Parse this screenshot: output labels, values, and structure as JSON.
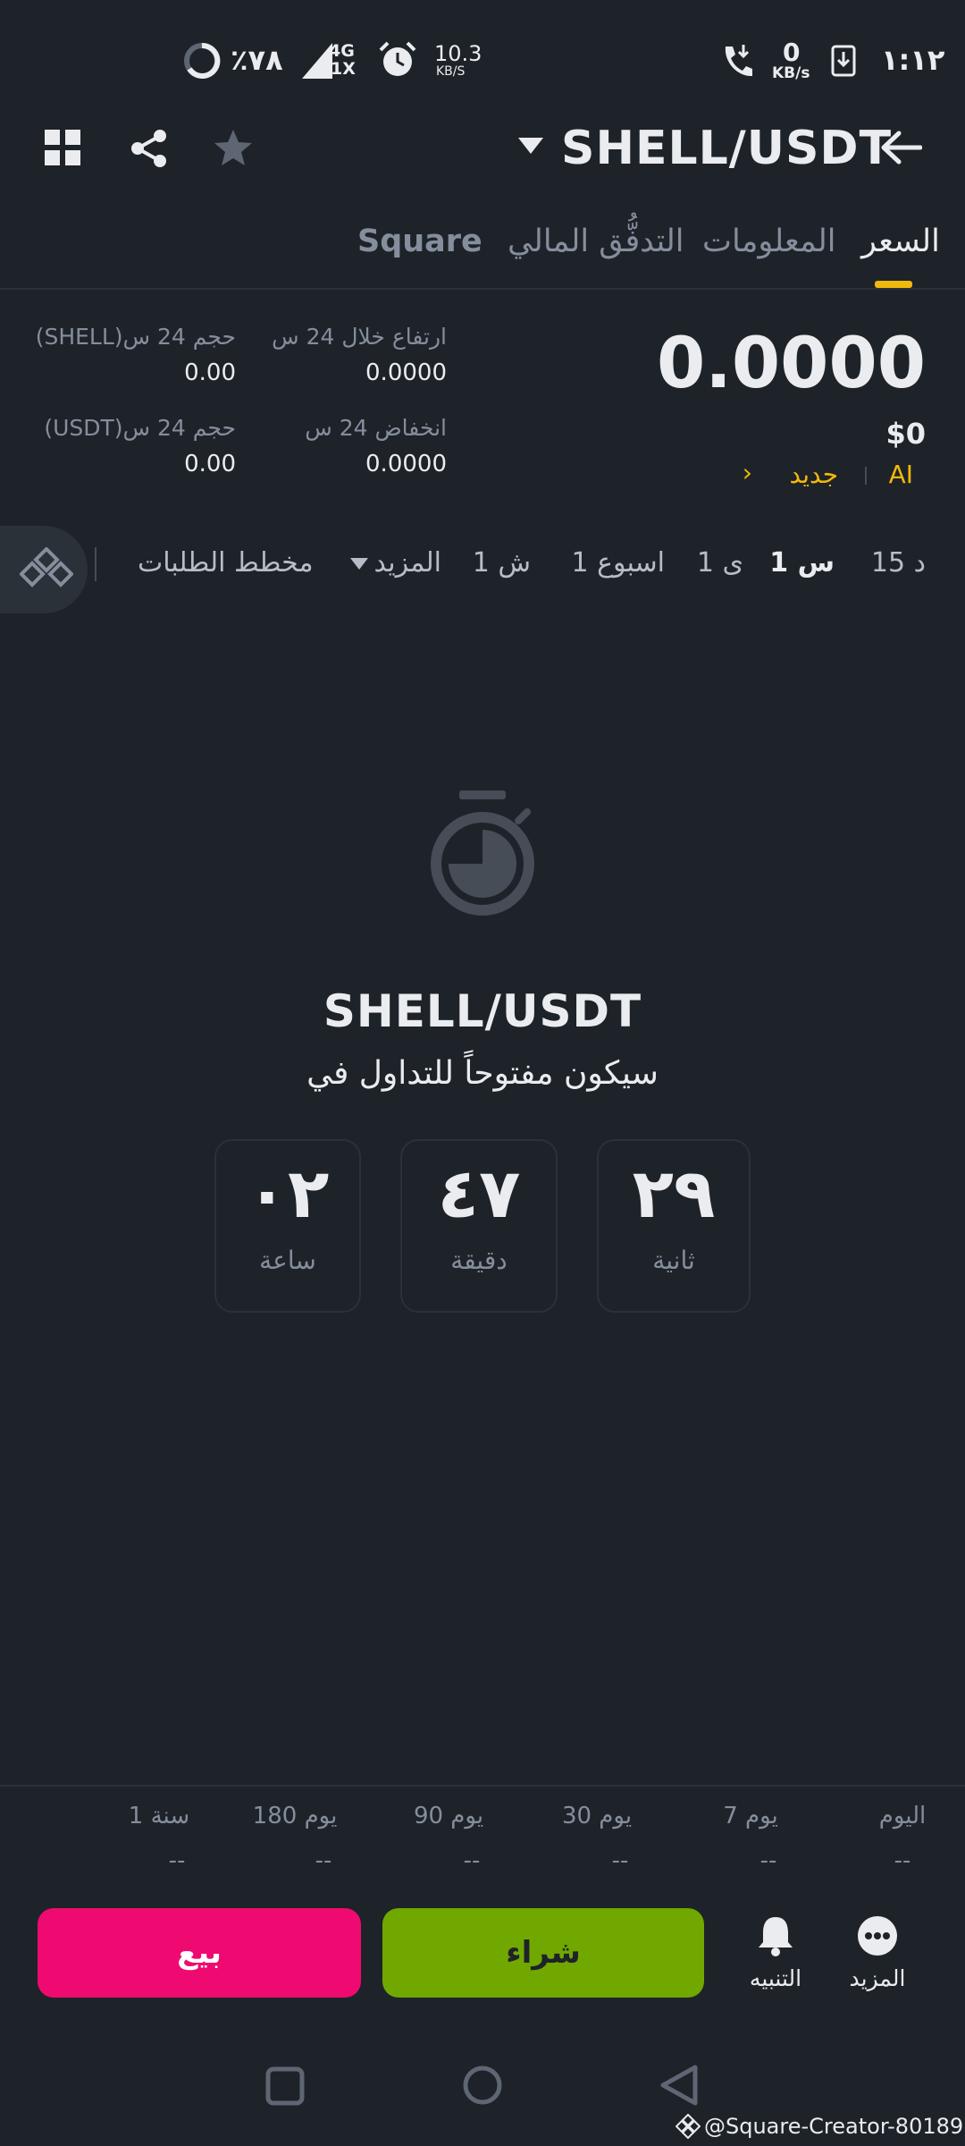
{
  "status_bar": {
    "time": "١:١٢",
    "net_speed_value": "0",
    "net_speed_unit": "KB/s",
    "data_speed": "10.3",
    "data_speed_unit": "KB/S",
    "network_top": "4G",
    "network_bottom": "1X",
    "battery": "٪٧٨"
  },
  "header": {
    "pair": "SHELL/USDT"
  },
  "tabs": [
    {
      "label": "السعر",
      "active": true
    },
    {
      "label": "المعلومات",
      "active": false
    },
    {
      "label": "التدفُّق المالي",
      "active": false
    },
    {
      "label": "Square",
      "active": false
    }
  ],
  "price": {
    "last": "0.0000",
    "usd": "$0",
    "ai_label": "AI",
    "new_label": "جديد"
  },
  "stats": {
    "high_label": "ارتفاع خلال 24 س",
    "high_value": "0.0000",
    "low_label": "انخفاض 24 س",
    "low_value": "0.0000",
    "vol_base_label": "حجم 24 س(SHELL)",
    "vol_base_value": "0.00",
    "vol_quote_label": "حجم 24 س(USDT)",
    "vol_quote_value": "0.00"
  },
  "timeframes": {
    "items": [
      "15 د",
      "1 س",
      "1 ی",
      "1 اسبوع",
      "1 ش"
    ],
    "active_index": 1,
    "more": "المزيد",
    "order_book": "مخطط الطلبات"
  },
  "countdown": {
    "title": "SHELL/USDT",
    "subtitle": "سيكون مفتوحاً للتداول في",
    "boxes": [
      {
        "value": "٢٩",
        "unit": "ثانية"
      },
      {
        "value": "٤٧",
        "unit": "دقيقة"
      },
      {
        "value": "٠٢",
        "unit": "ساعة"
      }
    ]
  },
  "performance": [
    {
      "label": "اليوم",
      "value": "--"
    },
    {
      "label": "7 يوم",
      "value": "--"
    },
    {
      "label": "30 يوم",
      "value": "--"
    },
    {
      "label": "90 يوم",
      "value": "--"
    },
    {
      "label": "180 يوم",
      "value": "--"
    },
    {
      "label": "1 سنة",
      "value": "--"
    }
  ],
  "bottom_bar": {
    "more_label": "المزيد",
    "alert_label": "التنبيه",
    "buy_label": "شراء",
    "sell_label": "بيع"
  },
  "watermark": "@Square-Creator-80189...",
  "colors": {
    "background": "#1e2329",
    "accent": "#f0b90b",
    "buy": "#70a800",
    "sell": "#ef0a71"
  }
}
